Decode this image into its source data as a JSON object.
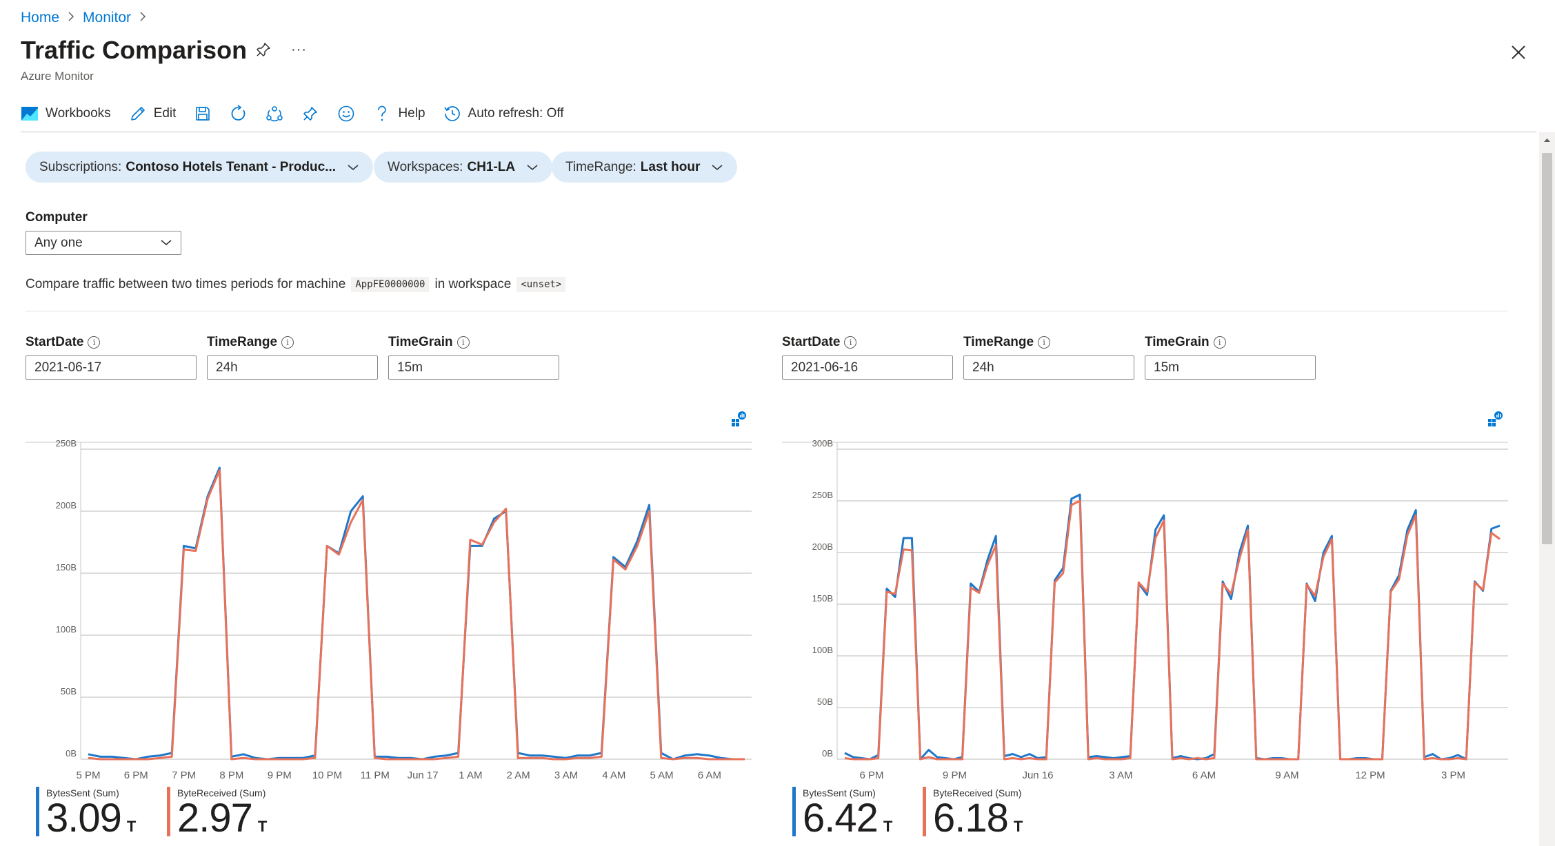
{
  "breadcrumb": {
    "items": [
      "Home",
      "Monitor"
    ]
  },
  "header": {
    "title": "Traffic Comparison",
    "subtitle": "Azure Monitor",
    "more_label": "···"
  },
  "toolbar": {
    "workbooks": "Workbooks",
    "edit": "Edit",
    "help": "Help",
    "autorefresh": "Auto refresh: Off"
  },
  "pills": [
    {
      "key": "Subscriptions:",
      "value": "Contoso Hotels Tenant - Produc..."
    },
    {
      "key": "Workspaces:",
      "value": "CH1-LA"
    },
    {
      "key": "TimeRange:",
      "value": "Last hour"
    }
  ],
  "computer": {
    "label": "Computer",
    "value": "Any one"
  },
  "description": {
    "prefix": "Compare traffic between two times periods for machine",
    "machine": "AppFE0000000",
    "middle": "in workspace",
    "workspace": "<unset>"
  },
  "params": {
    "left": {
      "startdate_label": "StartDate",
      "startdate": "2021-06-17",
      "timerange_label": "TimeRange",
      "timerange": "24h",
      "timegrain_label": "TimeGrain",
      "timegrain": "15m"
    },
    "right": {
      "startdate_label": "StartDate",
      "startdate": "2021-06-16",
      "timerange_label": "TimeRange",
      "timerange": "24h",
      "timegrain_label": "TimeGrain",
      "timegrain": "15m"
    }
  },
  "colors": {
    "accent": "#0078d4",
    "bytes_sent": "#1f77c9",
    "byte_received": "#e8715a",
    "pill_bg": "#deecf9"
  },
  "tiles": {
    "left": [
      {
        "label": "BytesSent (Sum)",
        "value": "3.09",
        "unit": "T"
      },
      {
        "label": "ByteReceived (Sum)",
        "value": "2.97",
        "unit": "T"
      }
    ],
    "right": [
      {
        "label": "BytesSent (Sum)",
        "value": "6.42",
        "unit": "T"
      },
      {
        "label": "ByteReceived (Sum)",
        "value": "6.18",
        "unit": "T"
      }
    ]
  },
  "chart_data": [
    {
      "type": "line",
      "title": "",
      "ylim": [
        0,
        250
      ],
      "yticks": [
        "0B",
        "50B",
        "100B",
        "150B",
        "200B",
        "250B"
      ],
      "xticks": [
        "5 PM",
        "6 PM",
        "7 PM",
        "8 PM",
        "9 PM",
        "10 PM",
        "11 PM",
        "Jun 17",
        "1 AM",
        "2 AM",
        "3 AM",
        "4 AM",
        "5 AM",
        "6 AM"
      ],
      "grid": true,
      "x_hours": [
        0,
        0.25,
        0.5,
        0.75,
        1,
        1.25,
        1.5,
        1.75,
        2,
        2.25,
        2.5,
        2.75,
        3,
        3.25,
        3.5,
        3.75,
        4,
        4.25,
        4.5,
        4.75,
        5,
        5.25,
        5.5,
        5.75,
        6,
        6.25,
        6.5,
        6.75,
        7,
        7.25,
        7.5,
        7.75,
        8,
        8.25,
        8.5,
        8.75,
        9,
        9.25,
        9.5,
        9.75,
        10,
        10.25,
        10.5,
        10.75,
        11,
        11.25,
        11.5,
        11.75,
        12,
        12.25,
        12.5,
        12.75,
        13,
        13.25,
        13.5,
        13.75,
        14,
        14.25,
        14.5,
        14.75,
        15,
        15.25,
        15.5
      ],
      "series": [
        {
          "name": "BytesSent",
          "values": [
            4,
            2,
            2,
            1,
            0,
            2,
            3,
            5,
            172,
            170,
            212,
            235,
            2,
            4,
            1,
            0,
            1,
            1,
            1,
            3,
            172,
            166,
            200,
            212,
            2,
            2,
            1,
            1,
            0,
            2,
            3,
            5,
            172,
            172,
            194,
            200,
            5,
            3,
            3,
            2,
            1,
            3,
            3,
            5,
            163,
            155,
            176,
            205,
            5,
            0,
            3,
            4,
            3,
            1,
            0,
            0
          ]
        },
        {
          "name": "ByteReceived",
          "values": [
            1,
            0,
            0,
            0,
            0,
            0,
            1,
            2,
            169,
            168,
            210,
            233,
            0,
            1,
            0,
            0,
            0,
            0,
            0,
            1,
            172,
            165,
            191,
            209,
            1,
            0,
            0,
            0,
            0,
            0,
            1,
            2,
            177,
            173,
            191,
            202,
            1,
            1,
            1,
            0,
            0,
            1,
            1,
            2,
            161,
            153,
            172,
            200,
            1,
            0,
            1,
            1,
            0,
            0,
            0,
            0
          ]
        }
      ]
    },
    {
      "type": "line",
      "title": "",
      "ylim": [
        0,
        300
      ],
      "yticks": [
        "0B",
        "50B",
        "100B",
        "150B",
        "200B",
        "250B",
        "300B"
      ],
      "xticks": [
        "6 PM",
        "9 PM",
        "Jun 16",
        "3 AM",
        "6 AM",
        "9 AM",
        "12 PM",
        "3 PM"
      ],
      "grid": true,
      "series": [
        {
          "name": "BytesSent",
          "values": [
            6,
            2,
            1,
            0,
            4,
            165,
            157,
            214,
            214,
            0,
            9,
            2,
            1,
            0,
            2,
            170,
            162,
            193,
            216,
            3,
            5,
            2,
            5,
            1,
            2,
            173,
            185,
            252,
            256,
            2,
            3,
            2,
            1,
            2,
            3,
            170,
            159,
            222,
            236,
            1,
            3,
            1,
            0,
            1,
            5,
            172,
            155,
            200,
            226,
            1,
            0,
            1,
            1,
            0,
            0,
            170,
            153,
            200,
            216,
            0,
            0,
            1,
            1,
            0,
            0,
            163,
            178,
            222,
            241,
            2,
            5,
            0,
            1,
            4,
            0,
            172,
            163,
            223,
            226
          ]
        },
        {
          "name": "ByteReceived",
          "values": [
            1,
            0,
            0,
            0,
            1,
            162,
            160,
            203,
            202,
            0,
            2,
            0,
            0,
            0,
            0,
            166,
            161,
            188,
            207,
            0,
            1,
            0,
            1,
            0,
            0,
            171,
            180,
            246,
            250,
            0,
            1,
            0,
            0,
            0,
            1,
            171,
            162,
            214,
            231,
            0,
            1,
            0,
            1,
            0,
            1,
            170,
            160,
            194,
            222,
            0,
            0,
            0,
            0,
            0,
            0,
            169,
            158,
            196,
            213,
            0,
            0,
            0,
            0,
            0,
            0,
            162,
            174,
            217,
            236,
            0,
            1,
            0,
            0,
            1,
            0,
            171,
            164,
            219,
            213
          ]
        }
      ]
    }
  ]
}
